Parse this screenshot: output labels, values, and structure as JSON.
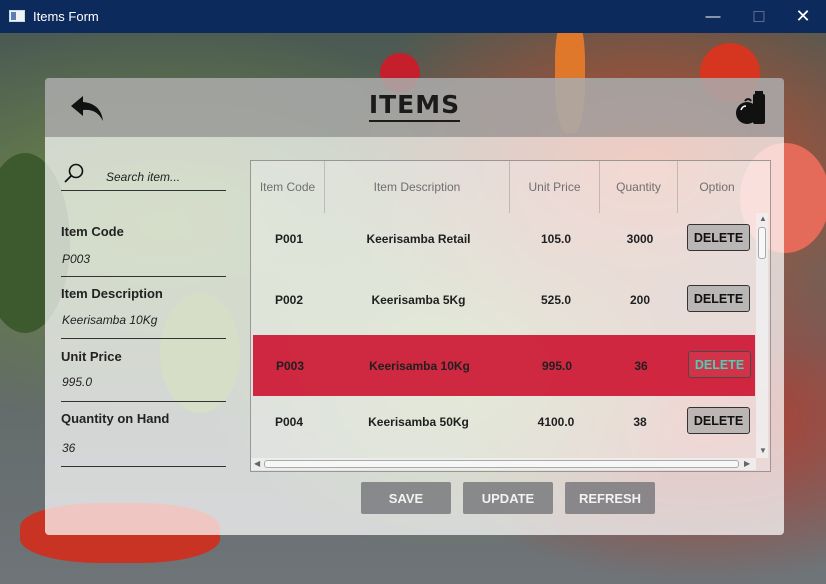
{
  "window": {
    "title": "Items Form",
    "min_glyph": "—",
    "max_glyph": "☐",
    "close_glyph": "✕"
  },
  "header": {
    "title": "ITEMS",
    "back_icon": "back-arrow-icon",
    "right_icon": "grocery-icon"
  },
  "search": {
    "placeholder": "Search item..."
  },
  "form": {
    "item_code": {
      "label": "Item Code",
      "value": "P003"
    },
    "item_description": {
      "label": "Item Description",
      "value": "Keerisamba 10Kg"
    },
    "unit_price": {
      "label": "Unit Price",
      "value": "995.0"
    },
    "quantity_on_hand": {
      "label": "Quantity on Hand",
      "value": "36"
    }
  },
  "table": {
    "columns": [
      "Item Code",
      "Item Description",
      "Unit Price",
      "Quantity",
      "Option"
    ],
    "selected_index": 2,
    "rows": [
      {
        "code": "P001",
        "description": "Keerisamba Retail",
        "price": "105.0",
        "qty": "3000",
        "option": "DELETE"
      },
      {
        "code": "P002",
        "description": "Keerisamba 5Kg",
        "price": "525.0",
        "qty": "200",
        "option": "DELETE"
      },
      {
        "code": "P003",
        "description": "Keerisamba 10Kg",
        "price": "995.0",
        "qty": "36",
        "option": "DELETE"
      },
      {
        "code": "P004",
        "description": "Keerisamba 50Kg",
        "price": "4100.0",
        "qty": "38",
        "option": "DELETE"
      }
    ]
  },
  "actions": {
    "save": "SAVE",
    "update": "UPDATE",
    "refresh": "REFRESH"
  },
  "colors": {
    "titlebar": "#0d2a5c",
    "selected_row": "#cc0828",
    "selected_delete_text": "#4bd0b8"
  }
}
